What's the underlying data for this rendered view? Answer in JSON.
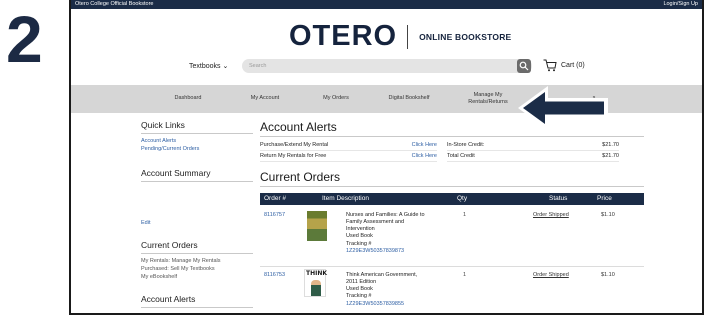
{
  "step_number": "2",
  "topbar": {
    "left": "Otero College Official Bookstore",
    "right": "Login/Sign Up"
  },
  "brand": {
    "name": "OTERO",
    "subtitle": "ONLINE BOOKSTORE"
  },
  "search": {
    "textbooks_label": "Textbooks",
    "placeholder": "Search"
  },
  "cart": {
    "label": "Cart (0)"
  },
  "nav": {
    "dashboard": "Dashboard",
    "account": "My Account",
    "orders": "My Orders",
    "bookshelf": "Digital Bookshelf",
    "manage_line1": "Manage My",
    "manage_line2": "Rentals/Returns",
    "partial": "s"
  },
  "sidebar": {
    "quick_links_title": "Quick Links",
    "links": [
      "Account Alerts",
      "Pending/Current Orders"
    ],
    "account_summary_title": "Account Summary",
    "edit": "Edit",
    "current_orders_title": "Current Orders",
    "current_orders_items": [
      "My Rentals: Manage My Rentals",
      "Purchased: Sell My Textbooks",
      "My eBookshelf"
    ],
    "account_alerts_title": "Account Alerts"
  },
  "account_alerts": {
    "title": "Account Alerts",
    "rows": [
      {
        "label": "Purchase/Extend My Rental",
        "action": "Click Here"
      },
      {
        "label": "Return My Rentals for Free",
        "action": "Click Here"
      }
    ],
    "credits": [
      {
        "label": "In-Store Credit:",
        "value": "$21.70"
      },
      {
        "label": "Total Credit",
        "value": "$21.70"
      }
    ]
  },
  "current_orders": {
    "title": "Current Orders",
    "columns": [
      "Order #",
      "Item Description",
      "Qty",
      "Status",
      "Price"
    ],
    "orders": [
      {
        "number": "8116757",
        "desc_lines": [
          "Nurses and Families: A Guide to",
          "Family Assessment and",
          "Intervention",
          "Used Book",
          "Tracking #"
        ],
        "tracking": "1Z29E3W50357839873",
        "qty": "1",
        "status": "Order Shipped",
        "price": "$1.10"
      },
      {
        "number": "8116753",
        "desc_lines": [
          "Think American Government,",
          "2011 Edition",
          "Used Book",
          "Tracking #"
        ],
        "tracking": "1Z29E3W50357839855",
        "qty": "1",
        "status": "Order Shipped",
        "price": "$1.10",
        "cover_text": "THINK"
      }
    ]
  },
  "colors": {
    "navy": "#1b2c47",
    "link": "#2d5ea3",
    "nav_bg": "#d6d6d6"
  }
}
